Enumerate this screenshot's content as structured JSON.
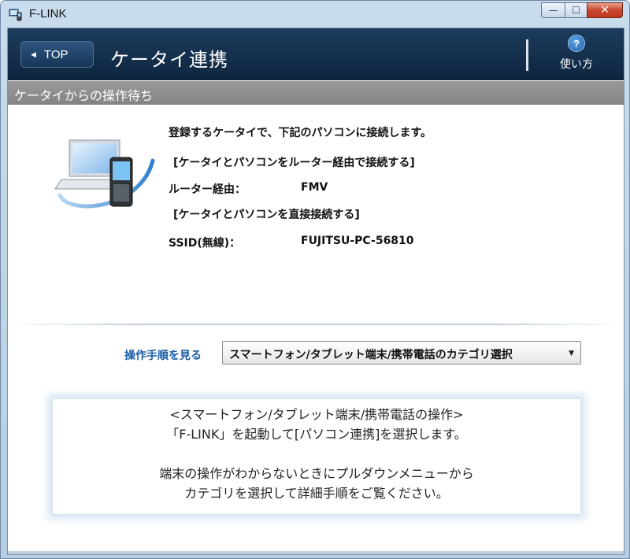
{
  "window": {
    "title": "F-LINK",
    "controls": {
      "minimize": "—",
      "maximize": "☐",
      "close": "✕"
    }
  },
  "navbar": {
    "back_label": "TOP",
    "page_title": "ケータイ連携",
    "help_symbol": "?",
    "help_label": "使い方"
  },
  "section": {
    "title": "ケータイからの操作待ち"
  },
  "info": {
    "intro": "登録するケータイで、下記のパソコンに接続します。",
    "router_heading": "[ケータイとパソコンをルーター経由で接続する]",
    "router_label": "ルーター経由：",
    "router_value": "FMV",
    "direct_heading": "[ケータイとパソコンを直接接続する]",
    "ssid_label": "SSID(無線)：",
    "ssid_value": "FUJITSU-PC-56810"
  },
  "procedure": {
    "label": "操作手順を見る",
    "selected": "スマートフォン/タブレット端末/携帯電話のカテゴリ選択"
  },
  "message": {
    "line1": "<スマートフォン/タブレット端末/携帯電話の操作>",
    "line2": "「F-LINK」を起動して[パソコン連携]を選択します。",
    "line3": "端末の操作がわからないときにプルダウンメニューから",
    "line4": "カテゴリを選択して詳細手順をご覧ください。"
  },
  "colors": {
    "navbar": "#163656",
    "section_band": "#8e8e8e",
    "procedure_label": "#1a5da8",
    "close_button": "#c7452c"
  }
}
